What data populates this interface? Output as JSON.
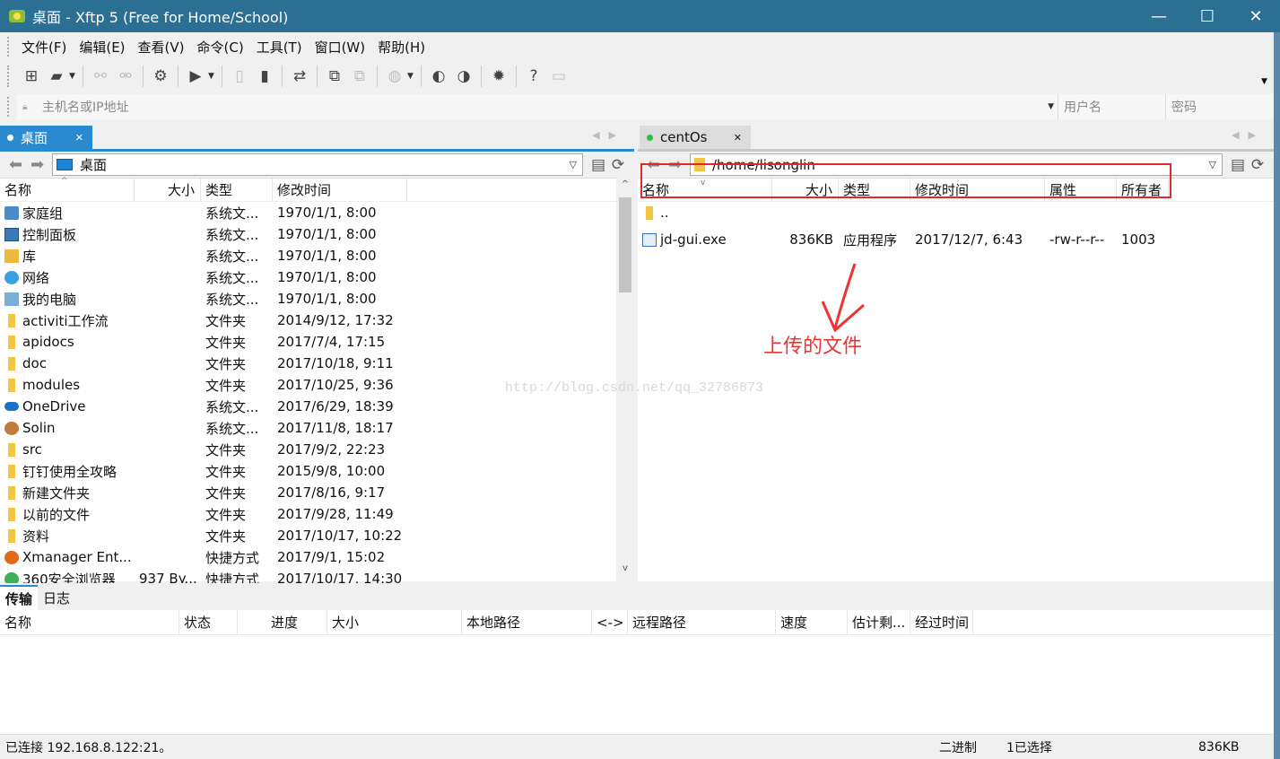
{
  "window": {
    "title": "桌面 - Xftp 5 (Free for Home/School)",
    "minimize": "—",
    "maximize": "☐",
    "close": "✕"
  },
  "menu": [
    "文件(F)",
    "编辑(E)",
    "查看(V)",
    "命令(C)",
    "工具(T)",
    "窗口(W)",
    "帮助(H)"
  ],
  "address": {
    "host_placeholder": "主机名或IP地址",
    "user_placeholder": "用户名",
    "pass_placeholder": "密码"
  },
  "left": {
    "tab_label": "桌面",
    "path": "桌面",
    "columns": {
      "name": "名称",
      "size": "大小",
      "type": "类型",
      "mtime": "修改时间"
    },
    "rows": [
      {
        "icon": "sys",
        "name": "家庭组",
        "size": "",
        "type": "系统文...",
        "mtime": "1970/1/1, 8:00"
      },
      {
        "icon": "ctrl",
        "name": "控制面板",
        "size": "",
        "type": "系统文...",
        "mtime": "1970/1/1, 8:00"
      },
      {
        "icon": "lib",
        "name": "库",
        "size": "",
        "type": "系统文...",
        "mtime": "1970/1/1, 8:00"
      },
      {
        "icon": "net",
        "name": "网络",
        "size": "",
        "type": "系统文...",
        "mtime": "1970/1/1, 8:00"
      },
      {
        "icon": "pc",
        "name": "我的电脑",
        "size": "",
        "type": "系统文...",
        "mtime": "1970/1/1, 8:00"
      },
      {
        "icon": "folder",
        "name": "activiti工作流",
        "size": "",
        "type": "文件夹",
        "mtime": "2014/9/12, 17:32"
      },
      {
        "icon": "folder",
        "name": "apidocs",
        "size": "",
        "type": "文件夹",
        "mtime": "2017/7/4, 17:15"
      },
      {
        "icon": "folder",
        "name": "doc",
        "size": "",
        "type": "文件夹",
        "mtime": "2017/10/18, 9:11"
      },
      {
        "icon": "folder",
        "name": "modules",
        "size": "",
        "type": "文件夹",
        "mtime": "2017/10/25, 9:36"
      },
      {
        "icon": "cloud",
        "name": "OneDrive",
        "size": "",
        "type": "系统文...",
        "mtime": "2017/6/29, 18:39"
      },
      {
        "icon": "user",
        "name": "Solin",
        "size": "",
        "type": "系统文...",
        "mtime": "2017/11/8, 18:17"
      },
      {
        "icon": "folder",
        "name": "src",
        "size": "",
        "type": "文件夹",
        "mtime": "2017/9/2, 22:23"
      },
      {
        "icon": "folder",
        "name": "钉钉使用全攻略",
        "size": "",
        "type": "文件夹",
        "mtime": "2015/9/8, 10:00"
      },
      {
        "icon": "folder",
        "name": "新建文件夹",
        "size": "",
        "type": "文件夹",
        "mtime": "2017/8/16, 9:17"
      },
      {
        "icon": "folder",
        "name": "以前的文件",
        "size": "",
        "type": "文件夹",
        "mtime": "2017/9/28, 11:49"
      },
      {
        "icon": "folder",
        "name": "资料",
        "size": "",
        "type": "文件夹",
        "mtime": "2017/10/17, 10:22"
      },
      {
        "icon": "xm",
        "name": "Xmanager Ent...",
        "size": "",
        "type": "快捷方式",
        "mtime": "2017/9/1, 15:02"
      },
      {
        "icon": "ie",
        "name": "360安全浏览器",
        "size": "937 By...",
        "type": "快捷方式",
        "mtime": "2017/10/17, 14:30"
      }
    ]
  },
  "right": {
    "tab_label": "centOs",
    "path": "/home/lisonglin",
    "columns": {
      "name": "名称",
      "size": "大小",
      "type": "类型",
      "mtime": "修改时间",
      "attr": "属性",
      "owner": "所有者"
    },
    "rows": [
      {
        "icon": "folder",
        "name": "..",
        "size": "",
        "type": "",
        "mtime": "",
        "attr": "",
        "owner": ""
      },
      {
        "icon": "exe",
        "name": "jd-gui.exe",
        "size": "836KB",
        "type": "应用程序",
        "mtime": "2017/12/7, 6:43",
        "attr": "-rw-r--r--",
        "owner": "1003"
      }
    ],
    "annotation": "上传的文件",
    "watermark": "http://blog.csdn.net/qq_32786873"
  },
  "transfer": {
    "tabs": [
      "传输",
      "日志"
    ],
    "columns": [
      "名称",
      "状态",
      "进度",
      "大小",
      "本地路径",
      "<->",
      "远程路径",
      "速度",
      "估计剩...",
      "经过时间"
    ]
  },
  "status": {
    "connection": "已连接 192.168.8.122:21。",
    "mode": "二进制",
    "selection": "1已选择",
    "size": "836KB"
  },
  "colors": {
    "titlebar": "#2b6f93",
    "tab_active": "#2a8ad0",
    "highlight": "#e02a2a",
    "annotation": "#e33333"
  }
}
